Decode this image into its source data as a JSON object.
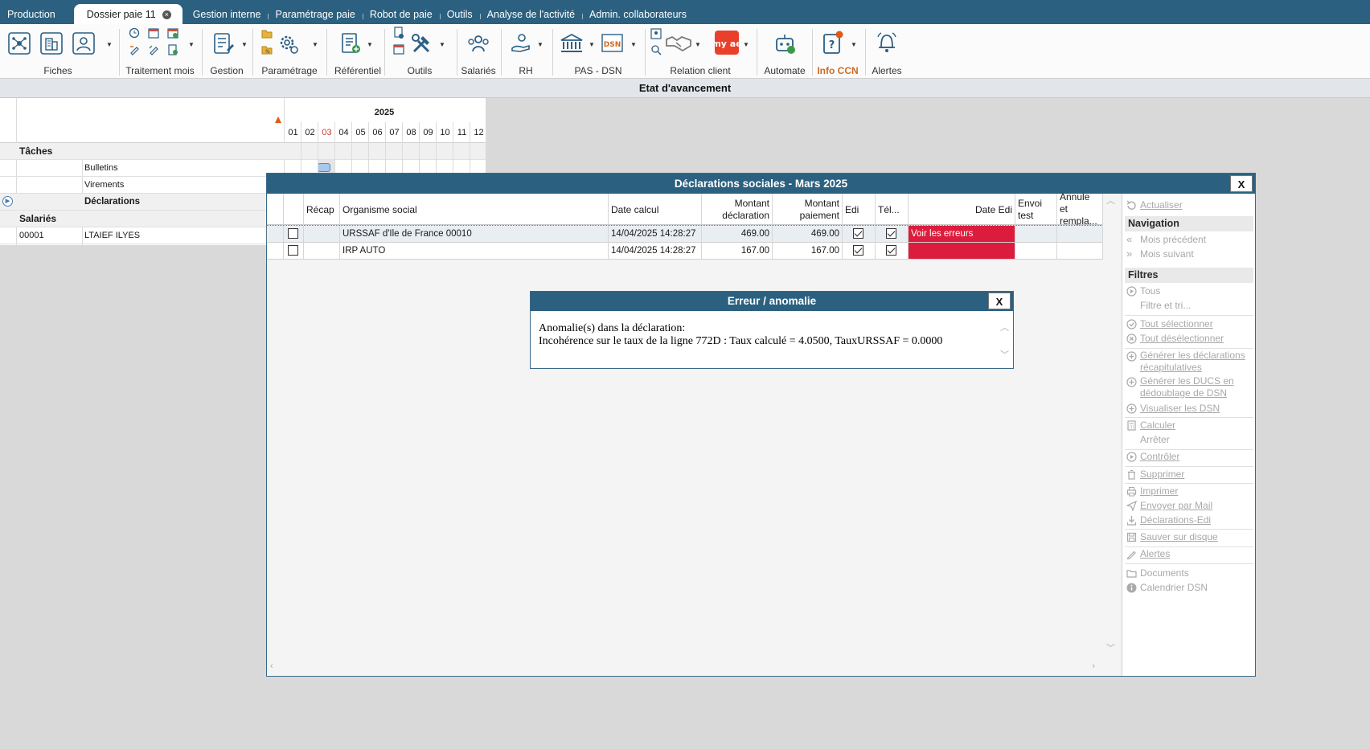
{
  "tabs": [
    {
      "label": "Production",
      "active": false
    },
    {
      "label": "Dossier paie 11",
      "active": true
    },
    {
      "label": "Gestion interne",
      "active": false
    },
    {
      "label": "Paramétrage paie",
      "active": false
    },
    {
      "label": "Robot de paie",
      "active": false
    },
    {
      "label": "Outils",
      "active": false
    },
    {
      "label": "Analyse de l'activité",
      "active": false
    },
    {
      "label": "Admin. collaborateurs",
      "active": false
    }
  ],
  "ribbon": {
    "groups": {
      "fiches": "Fiches",
      "traitement": "Traitement mois",
      "gestion": "Gestion",
      "parametrage": "Paramétrage",
      "referentiel": "Référentiel",
      "outils": "Outils",
      "salaries": "Salariés",
      "rh": "RH",
      "pas_dsn": "PAS - DSN",
      "relation": "Relation client",
      "automate": "Automate",
      "info_ccn": "Info CCN",
      "alertes": "Alertes"
    },
    "dsn_icon_text": "DSN",
    "myae_icon_text": "my ae"
  },
  "section_title": "Etat d'avancement",
  "planning": {
    "year": "2025",
    "months": [
      "01",
      "02",
      "03",
      "04",
      "05",
      "06",
      "07",
      "08",
      "09",
      "10",
      "11",
      "12"
    ],
    "current_month": "03",
    "tasks_header": "Tâches",
    "tasks": [
      "Bulletins",
      "Virements",
      "Déclarations"
    ],
    "employees_header": "Salariés",
    "employees": [
      {
        "code": "00001",
        "name": "LTAIEF ILYES"
      }
    ]
  },
  "dialog": {
    "title": "Déclarations sociales - Mars 2025",
    "close": "X",
    "columns": {
      "recap": "Récap",
      "organisme": "Organisme social",
      "date_calcul": "Date calcul",
      "montant_decl": "Montant déclaration",
      "montant_paie": "Montant paiement",
      "edi": "Edi",
      "tel": "Tél...",
      "date_edi": "Date Edi",
      "envoi_test": "Envoi test",
      "annule": "Annule et rempla..."
    },
    "rows": [
      {
        "organisme": "URSSAF d'Ile de France 00010",
        "date_calcul": "14/04/2025 14:28:27",
        "montant_decl": "469.00",
        "montant_paie": "469.00",
        "edi": true,
        "tel": true,
        "date_edi": "Voir les erreurs"
      },
      {
        "organisme": "IRP AUTO",
        "date_calcul": "14/04/2025 14:28:27",
        "montant_decl": "167.00",
        "montant_paie": "167.00",
        "edi": true,
        "tel": true,
        "date_edi": ""
      }
    ]
  },
  "side_panel": {
    "actualiser": "Actualiser",
    "navigation": "Navigation",
    "mois_precedent": "Mois précédent",
    "mois_suivant": "Mois suivant",
    "filtres": "Filtres",
    "tous": "Tous",
    "filtre_tri": "Filtre et tri...",
    "tout_selectionner": "Tout sélectionner",
    "tout_deselectionner": "Tout désélectionner",
    "generer_recap_1": "Générer les déclarations",
    "generer_recap_2": "récapitulatives",
    "generer_ducs_1": "Générer les DUCS en",
    "generer_ducs_2": "dédoublage de DSN",
    "visualiser_dsn": "Visualiser les DSN",
    "calculer": "Calculer",
    "arreter": "Arrêter",
    "controler": "Contrôler",
    "supprimer": "Supprimer",
    "imprimer": "Imprimer",
    "envoyer_mail": "Envoyer par Mail",
    "declarations_edi": "Déclarations-Edi",
    "sauver_disque": "Sauver sur disque",
    "alertes": "Alertes",
    "documents": "Documents",
    "calendrier_dsn": "Calendrier DSN"
  },
  "popup": {
    "title": "Erreur / anomalie",
    "close": "X",
    "line1": "Anomalie(s) dans la déclaration:",
    "line2": "Incohérence sur le taux de la ligne 772D : Taux calculé = 4.0500, TauxURSSAF = 0.0000"
  },
  "colors": {
    "header_blue": "#2b6080",
    "error_red": "#dc1c3c",
    "info_ccn_orange": "#d2691e",
    "current_month_red": "#c83c3c"
  }
}
